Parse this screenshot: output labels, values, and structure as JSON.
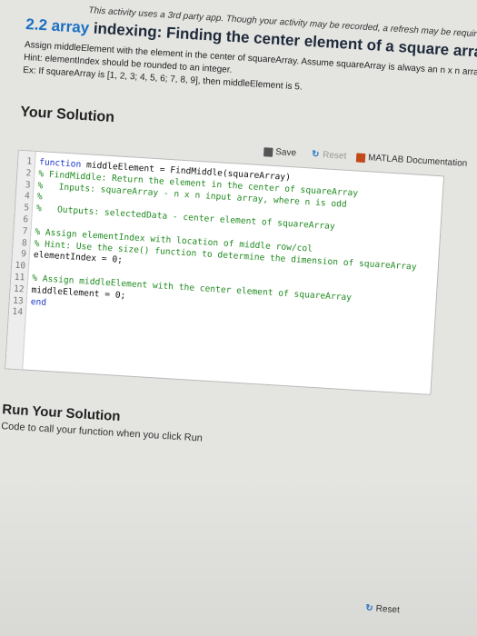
{
  "banner": "This activity uses a 3rd party app. Though your activity may be recorded, a refresh may be required to update the banner to the left.",
  "heading": {
    "lead": "2.2 array",
    "rest": " indexing: Finding the center element of a square array"
  },
  "instructions": [
    "Assign middleElement with the element in the center of squareArray. Assume squareArray is always an n x n array, where n is odd.",
    "Hint: elementIndex should be rounded to an integer.",
    "Ex: If squareArray is [1, 2, 3; 4, 5, 6; 7, 8, 9], then middleElement is 5."
  ],
  "your_solution": {
    "title": "Your Solution",
    "toolbar": {
      "save_label": "Save",
      "reset_label": "Reset",
      "doc_label": "MATLAB Documentation"
    },
    "line_numbers": [
      "1",
      "2",
      "3",
      "4",
      "5",
      "6",
      "7",
      "8",
      "9",
      "10",
      "11",
      "12",
      "13",
      "14"
    ],
    "code": {
      "l1_kw": "function",
      "l1_rest": " middleElement = FindMiddle(squareArray)",
      "l2": "% FindMiddle: Return the element in the center of squareArray",
      "l3": "%   Inputs: squareArray - n x n input array, where n is odd",
      "l4": "%",
      "l5": "%   Outputs: selectedData - center element of squareArray",
      "l6": "",
      "l7": "% Assign elementIndex with location of middle row/col",
      "l8": "% Hint: Use the size() function to determine the dimension of squareArray",
      "l9": "elementIndex = 0;",
      "l10": "",
      "l11": "% Assign middleElement with the center element of squareArray",
      "l12": "middleElement = 0;",
      "l13_kw": "end",
      "l14": ""
    }
  },
  "run": {
    "title": "Run Your Solution",
    "text": "Code to call your function when you click Run",
    "reset_label": "Reset"
  }
}
